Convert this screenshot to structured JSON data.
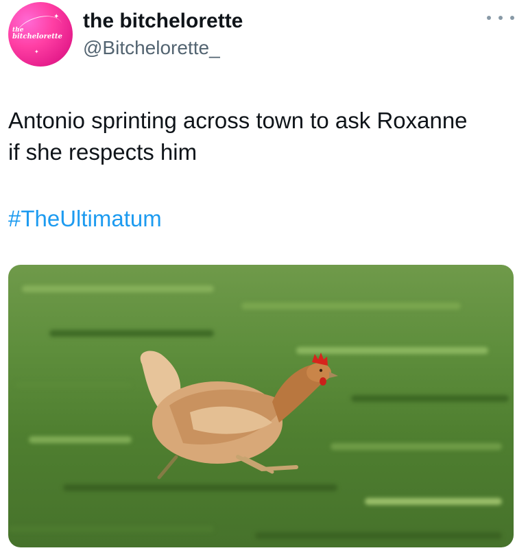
{
  "tweet": {
    "avatar": {
      "logo_text_top": "the",
      "logo_text_main": "bitchelorette",
      "brand_color": "#e61e8c"
    },
    "display_name": "the bitchelorette",
    "handle": "@Bitchelorette_",
    "more_icon": "more-horizontal-icon",
    "text_line_1": "Antonio sprinting across town to ask Roxanne",
    "text_line_2": "if she respects him",
    "hashtag": "#TheUltimatum",
    "hashtag_color": "#1d9bf0"
  }
}
